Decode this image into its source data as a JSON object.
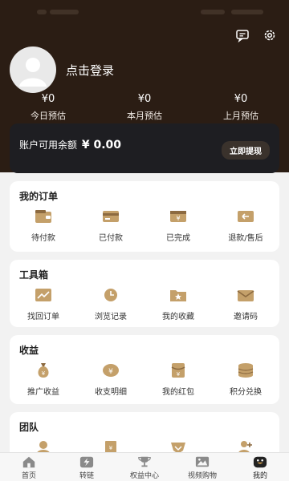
{
  "colors": {
    "header_bg": "#2b1d14",
    "accent": "#c4a06a",
    "accent_dark": "#8c6a40",
    "balance_bg": "#1e1e22"
  },
  "header": {
    "top_icons": [
      "message-icon",
      "settings-icon"
    ]
  },
  "profile": {
    "login_label": "点击登录"
  },
  "stats": [
    {
      "value": "¥0",
      "label": "今日预估"
    },
    {
      "value": "¥0",
      "label": "本月预估"
    },
    {
      "value": "¥0",
      "label": "上月预估"
    }
  ],
  "balance": {
    "label": "账户可用余额",
    "amount": "¥ 0.00",
    "withdraw_label": "立即提现"
  },
  "orders": {
    "title": "我的订单",
    "items": [
      {
        "label": "待付款",
        "icon": "wallet-icon"
      },
      {
        "label": "已付款",
        "icon": "card-icon"
      },
      {
        "label": "已完成",
        "icon": "yen-box-icon"
      },
      {
        "label": "退款/售后",
        "icon": "return-icon"
      }
    ]
  },
  "tools": {
    "title": "工具箱",
    "items": [
      {
        "label": "找回订单",
        "icon": "chart-icon"
      },
      {
        "label": "浏览记录",
        "icon": "clock-icon"
      },
      {
        "label": "我的收藏",
        "icon": "folder-star-icon"
      },
      {
        "label": "邀请码",
        "icon": "envelope-icon"
      }
    ]
  },
  "income": {
    "title": "收益",
    "items": [
      {
        "label": "推广收益",
        "icon": "money-bag-icon"
      },
      {
        "label": "收支明细",
        "icon": "yen-coin-icon"
      },
      {
        "label": "我的红包",
        "icon": "red-packet-icon"
      },
      {
        "label": "积分兑换",
        "icon": "coin-stack-icon"
      }
    ]
  },
  "team": {
    "title": "团队",
    "items": [
      {
        "icon": "team-icon"
      },
      {
        "icon": "document-icon"
      },
      {
        "icon": "badge-icon"
      },
      {
        "icon": "add-user-icon"
      }
    ]
  },
  "tabbar": [
    {
      "label": "首页",
      "icon": "home-icon",
      "active": false
    },
    {
      "label": "转链",
      "icon": "lightning-icon",
      "active": false
    },
    {
      "label": "权益中心",
      "icon": "trophy-icon",
      "active": false
    },
    {
      "label": "视频购物",
      "icon": "video-icon",
      "active": false
    },
    {
      "label": "我的",
      "icon": "smile-icon",
      "active": true
    }
  ]
}
